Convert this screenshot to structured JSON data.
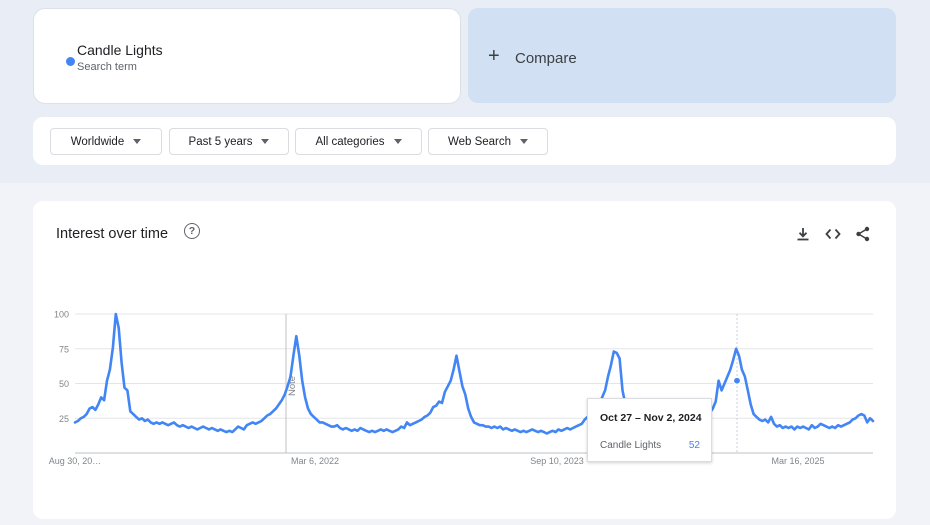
{
  "search_term": {
    "name": "Candle Lights",
    "subtitle": "Search term",
    "color": "#4285f4"
  },
  "compare": {
    "icon": "plus-icon",
    "label": "Compare"
  },
  "filters": {
    "region": "Worldwide",
    "time_range": "Past 5 years",
    "category": "All categories",
    "search_type": "Web Search"
  },
  "chart_section": {
    "title": "Interest over time",
    "icons": [
      "help-icon",
      "download-icon",
      "embed-code-icon",
      "share-icon"
    ]
  },
  "tooltip": {
    "date_range": "Oct 27 – Nov 2, 2024",
    "series": "Candle Lights",
    "value": "52"
  },
  "annotation": {
    "label": "Note"
  },
  "chart_data": {
    "type": "line",
    "title": "",
    "xlabel": "",
    "ylabel": "",
    "ylim": [
      0,
      100
    ],
    "y_ticks": [
      "25",
      "50",
      "75",
      "100"
    ],
    "x_tick_labels": [
      "Aug 30, 20…",
      "Mar 6, 2022",
      "Sep 10, 2023",
      "Mar 16, 2025"
    ],
    "grid": true,
    "legend": "none",
    "series_color": "#4285f4",
    "series": [
      {
        "values": [
          22,
          23,
          25,
          26,
          28,
          32,
          33,
          31,
          35,
          40,
          38,
          52,
          60,
          76,
          100,
          90,
          65,
          47,
          45,
          30,
          28,
          26,
          24,
          25,
          23,
          24,
          22,
          21,
          22,
          21,
          22,
          21,
          20,
          21,
          22,
          20,
          19,
          20,
          19,
          18,
          19,
          18,
          17,
          18,
          19,
          18,
          17,
          18,
          17,
          16,
          17,
          16,
          15,
          16,
          15,
          17,
          19,
          18,
          17,
          20,
          21,
          22,
          21,
          22,
          23,
          25,
          27,
          28,
          30,
          32,
          35,
          38,
          42,
          48,
          55,
          70,
          84,
          70,
          52,
          40,
          32,
          28,
          26,
          24,
          22,
          22,
          21,
          20,
          19,
          19,
          20,
          18,
          17,
          18,
          17,
          16,
          17,
          16,
          18,
          17,
          16,
          15,
          16,
          15,
          16,
          17,
          16,
          17,
          16,
          15,
          16,
          17,
          19,
          18,
          22,
          20,
          21,
          22,
          23,
          24,
          26,
          27,
          29,
          33,
          34,
          37,
          36,
          44,
          48,
          52,
          60,
          70,
          59,
          48,
          42,
          32,
          26,
          22,
          21,
          20,
          20,
          19,
          19,
          18,
          19,
          18,
          19,
          17,
          18,
          17,
          16,
          17,
          16,
          15,
          16,
          15,
          16,
          17,
          16,
          15,
          16,
          15,
          14,
          15,
          16,
          15,
          17,
          16,
          17,
          18,
          17,
          18,
          19,
          20,
          21,
          24,
          26,
          28,
          29,
          32,
          34,
          40,
          45,
          55,
          63,
          73,
          72,
          68,
          45,
          35,
          28,
          24,
          22,
          20,
          20,
          19,
          19,
          18,
          19,
          18,
          19,
          18,
          17,
          18,
          17,
          16,
          17,
          18,
          17,
          18,
          19,
          20,
          21,
          22,
          24,
          25,
          26,
          28,
          29,
          32,
          37,
          52,
          45,
          50,
          55,
          60,
          67,
          75,
          70,
          60,
          55,
          45,
          35,
          28,
          26,
          24,
          23,
          24,
          22,
          26,
          21,
          19,
          20,
          18,
          19,
          18,
          19,
          17,
          19,
          18,
          19,
          18,
          17,
          20,
          18,
          19,
          21,
          20,
          19,
          18,
          19,
          18,
          20,
          19,
          20,
          21,
          22,
          24,
          25,
          27,
          28,
          27,
          22,
          25,
          23
        ]
      }
    ],
    "highlight": {
      "label": "Oct 27 – Nov 2, 2024",
      "value": 52
    }
  }
}
